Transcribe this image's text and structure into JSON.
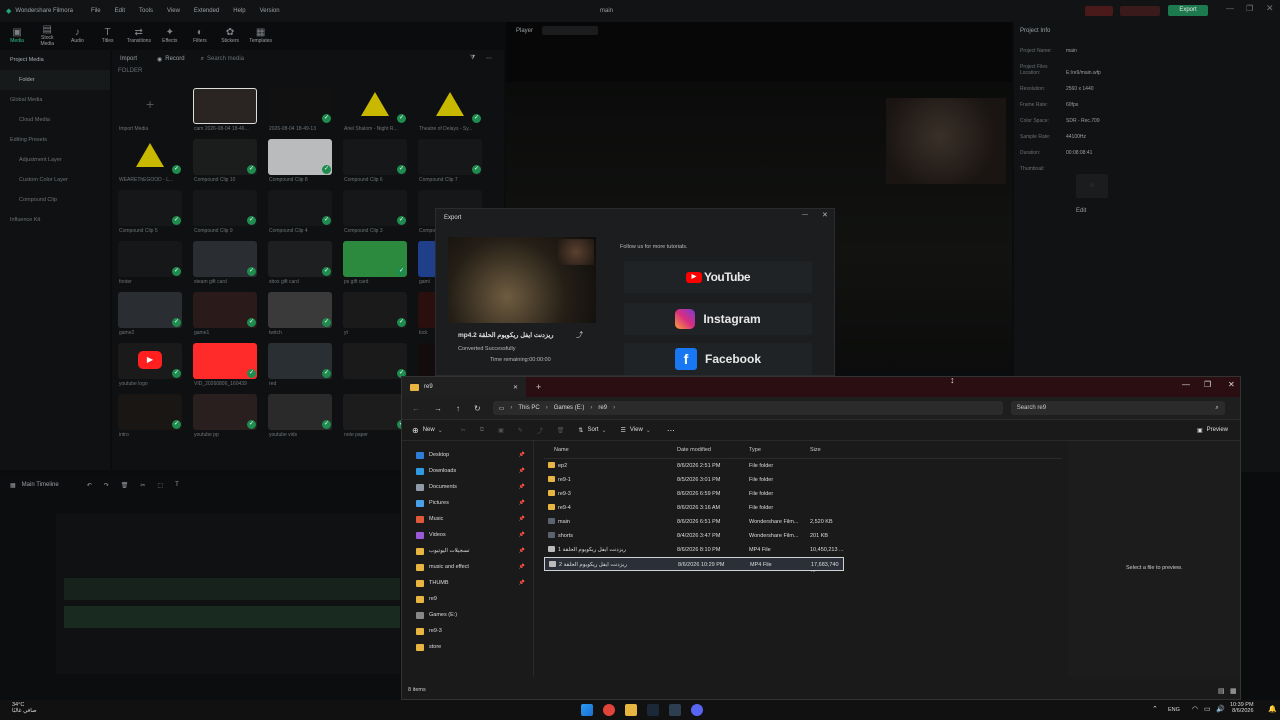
{
  "app": {
    "name": "Wondershare Filmora",
    "menu": [
      "File",
      "Edit",
      "Tools",
      "View",
      "Extended",
      "Help",
      "Version"
    ],
    "project_title": "main",
    "export_label": "Export"
  },
  "toolbar": [
    "Media",
    "Stock Media",
    "Audio",
    "Titles",
    "Transitions",
    "Effects",
    "Filters",
    "Stickers",
    "Templates"
  ],
  "leftnav": [
    "Project Media",
    "Folder",
    "Global Media",
    "Cloud Media",
    "Editing Presets",
    "Adjustment Layer",
    "Custom Color Layer",
    "Compound Clip",
    "Influence Kit"
  ],
  "media": {
    "import_label": "Import",
    "record_label": "Record",
    "search_placeholder": "Search media",
    "folder_label": "FOLDER",
    "items": [
      "Import Media",
      "cam 2026-08-04 18-46...",
      "2026-08-04 18-49-13",
      "Ariel Shalom - Night R...",
      "Theatre of Delays - Sy...",
      "WEAREThEGOOD - L...",
      "Compound Clip 10",
      "Compound Clip 8",
      "Compound Clip 6",
      "Compound Clip 7",
      "Compound Clip 5",
      "Compound Clip 9",
      "Compound Clip 4",
      "Compound Clip 3",
      "Compound Clip 2",
      "footer",
      "steam gift card",
      "xbox gift card",
      "ps gift card",
      "gami",
      "game2",
      "game1",
      "twitch",
      "yt",
      "kick",
      "youtube logo",
      "VID_20260806_160439",
      "red",
      "",
      "Compound Clip 1",
      "intro",
      "youtube pp",
      "youtube vids",
      "note paper"
    ]
  },
  "player": {
    "label": "Player"
  },
  "project_info": {
    "title": "Project Info",
    "rows": [
      {
        "k": "Project Name:",
        "v": "main"
      },
      {
        "k": "Project Files Location:",
        "v": "E:/re9/main.wfp"
      },
      {
        "k": "Resolution:",
        "v": "2560 x 1440"
      },
      {
        "k": "Frame Rate:",
        "v": "60fps"
      },
      {
        "k": "Color Space:",
        "v": "SDR - Rec.709"
      },
      {
        "k": "Sample Rate:",
        "v": "44100Hz"
      },
      {
        "k": "Duration:",
        "v": "00:08:08:41"
      },
      {
        "k": "Thumbnail:",
        "v": ""
      }
    ],
    "edit_label": "Edit"
  },
  "timeline": {
    "label": "Main Timeline"
  },
  "export_dialog": {
    "title": "Export",
    "file_name": "mp4.2 ريزدنت ايفل ريكويوم الحلقة",
    "status": "Converted Successfully",
    "time_remaining": "Time remaining:00:00:00",
    "follow_text": "Follow us for more tutorials.",
    "socials": [
      "YouTube",
      "Instagram",
      "Facebook"
    ]
  },
  "explorer": {
    "tab_title": "re9",
    "breadcrumb": [
      "This PC",
      "Games (E:)",
      "re9"
    ],
    "search_placeholder": "Search re9",
    "commands": {
      "new": "New",
      "sort": "Sort",
      "view": "View",
      "preview": "Preview"
    },
    "columns": [
      "Name",
      "Date modified",
      "Type",
      "Size"
    ],
    "files": [
      {
        "name": "ep2",
        "date": "8/6/2026 2:51 PM",
        "type": "File folder",
        "size": "",
        "kind": "folder"
      },
      {
        "name": "re9-1",
        "date": "8/5/2026 3:01 PM",
        "type": "File folder",
        "size": "",
        "kind": "folder"
      },
      {
        "name": "re9-3",
        "date": "8/6/2026 6:59 PM",
        "type": "File folder",
        "size": "",
        "kind": "folder"
      },
      {
        "name": "re9-4",
        "date": "8/6/2026 3:16 AM",
        "type": "File folder",
        "size": "",
        "kind": "folder"
      },
      {
        "name": "main",
        "date": "8/6/2026 6:51 PM",
        "type": "Wondershare Film...",
        "size": "2,520 KB",
        "kind": "project"
      },
      {
        "name": "shorts",
        "date": "8/4/2026 3:47 PM",
        "type": "Wondershare Film...",
        "size": "201 KB",
        "kind": "project"
      },
      {
        "name": "ريزدنت ايفل ريكويوم الحلقة 1",
        "date": "8/6/2026 8:10 PM",
        "type": "MP4 File",
        "size": "10,450,213 ...",
        "kind": "video"
      },
      {
        "name": "ريزدنت ايفل ريكويوم الحلقة 2",
        "date": "8/6/2026 10:29 PM",
        "type": "MP4 File",
        "size": "17,683,740 ...",
        "kind": "video"
      }
    ],
    "nav": [
      {
        "label": "Desktop",
        "pinned": true
      },
      {
        "label": "Downloads",
        "pinned": true
      },
      {
        "label": "Documents",
        "pinned": true
      },
      {
        "label": "Pictures",
        "pinned": true
      },
      {
        "label": "Music",
        "pinned": true
      },
      {
        "label": "Videos",
        "pinned": true
      },
      {
        "label": "تسجيلات اليوتيوب",
        "pinned": true
      },
      {
        "label": "music and effect",
        "pinned": true
      },
      {
        "label": "THUMB",
        "pinned": true
      },
      {
        "label": "re9",
        "pinned": false
      },
      {
        "label": "Games (E:)",
        "pinned": false
      },
      {
        "label": "re9-3",
        "pinned": false
      },
      {
        "label": "store",
        "pinned": false
      }
    ],
    "preview_text": "Select a file to preview.",
    "status": "8 items"
  },
  "taskbar": {
    "weather_temp": "34°C",
    "weather_text": "صافي غالبًا",
    "lang": "ENG",
    "time": "10:39 PM",
    "date": "8/6/2026"
  }
}
